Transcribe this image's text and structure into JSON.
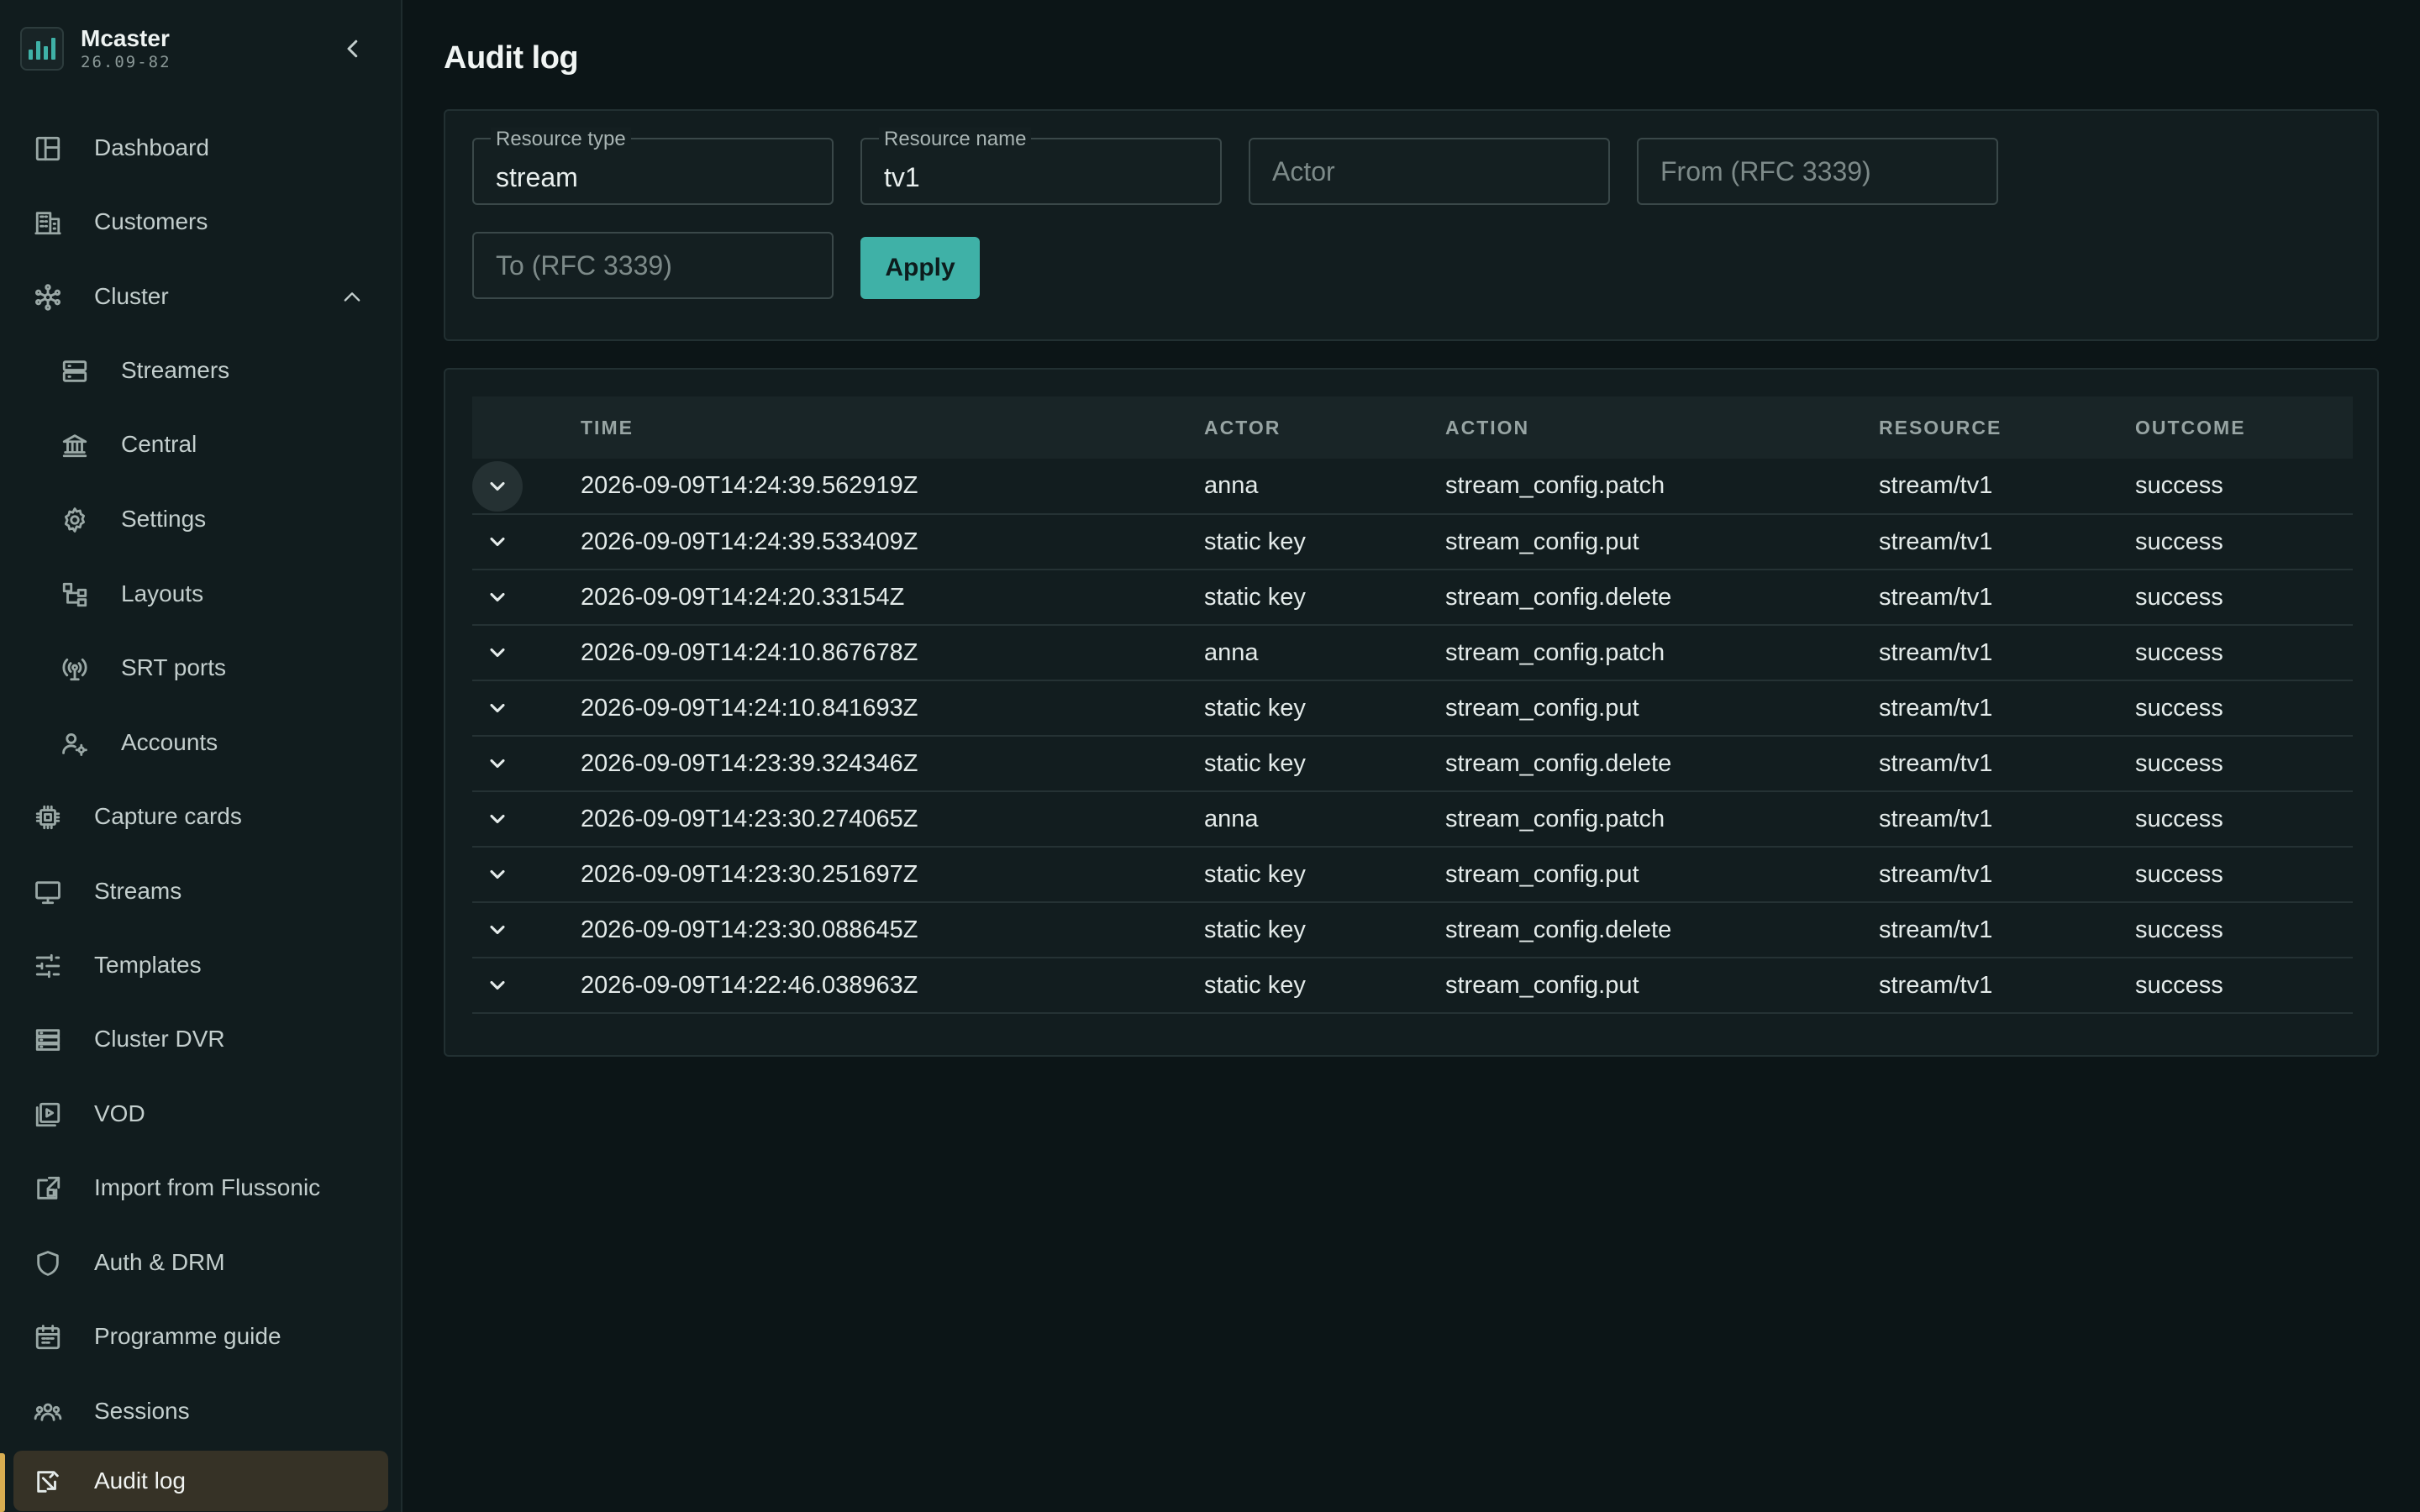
{
  "app": {
    "name": "Mcaster",
    "version": "26.09-82"
  },
  "colors": {
    "accent": "#3fb1a7",
    "active_indicator": "#d8ad51",
    "background": "#0c1517",
    "sidebar": "#111c1e"
  },
  "sidebar": {
    "collapse_icon": "chevron-left-icon",
    "items": [
      {
        "label": "Dashboard",
        "icon": "dashboard-icon"
      },
      {
        "label": "Customers",
        "icon": "building-icon"
      },
      {
        "label": "Cluster",
        "icon": "cluster-icon",
        "expanded": true
      },
      {
        "label": "Streamers",
        "icon": "server-icon"
      },
      {
        "label": "Central",
        "icon": "bank-icon"
      },
      {
        "label": "Settings",
        "icon": "gear-icon"
      },
      {
        "label": "Layouts",
        "icon": "hierarchy-icon"
      },
      {
        "label": "SRT ports",
        "icon": "antenna-icon"
      },
      {
        "label": "Accounts",
        "icon": "user-gear-icon"
      },
      {
        "label": "Capture cards",
        "icon": "chip-icon"
      },
      {
        "label": "Streams",
        "icon": "monitor-icon"
      },
      {
        "label": "Templates",
        "icon": "sliders-icon"
      },
      {
        "label": "Cluster DVR",
        "icon": "storage-icon"
      },
      {
        "label": "VOD",
        "icon": "video-library-icon"
      },
      {
        "label": "Import from Flussonic",
        "icon": "import-icon"
      },
      {
        "label": "Auth & DRM",
        "icon": "shield-icon"
      },
      {
        "label": "Programme guide",
        "icon": "calendar-icon"
      },
      {
        "label": "Sessions",
        "icon": "users-icon"
      },
      {
        "label": "Audit log",
        "icon": "audit-icon",
        "active": true
      }
    ]
  },
  "page": {
    "title": "Audit log"
  },
  "filters": {
    "resource_type": {
      "label": "Resource type",
      "value": "stream"
    },
    "resource_name": {
      "label": "Resource name",
      "value": "tv1"
    },
    "actor": {
      "placeholder": "Actor",
      "value": ""
    },
    "from": {
      "placeholder": "From (RFC 3339)",
      "value": ""
    },
    "to": {
      "placeholder": "To (RFC 3339)",
      "value": ""
    },
    "apply_label": "Apply"
  },
  "table": {
    "columns": [
      "TIME",
      "ACTOR",
      "ACTION",
      "RESOURCE",
      "OUTCOME"
    ],
    "rows": [
      {
        "time": "2026-09-09T14:24:39.562919Z",
        "actor": "anna",
        "action": "stream_config.patch",
        "resource": "stream/tv1",
        "outcome": "success"
      },
      {
        "time": "2026-09-09T14:24:39.533409Z",
        "actor": "static key",
        "action": "stream_config.put",
        "resource": "stream/tv1",
        "outcome": "success"
      },
      {
        "time": "2026-09-09T14:24:20.33154Z",
        "actor": "static key",
        "action": "stream_config.delete",
        "resource": "stream/tv1",
        "outcome": "success"
      },
      {
        "time": "2026-09-09T14:24:10.867678Z",
        "actor": "anna",
        "action": "stream_config.patch",
        "resource": "stream/tv1",
        "outcome": "success"
      },
      {
        "time": "2026-09-09T14:24:10.841693Z",
        "actor": "static key",
        "action": "stream_config.put",
        "resource": "stream/tv1",
        "outcome": "success"
      },
      {
        "time": "2026-09-09T14:23:39.324346Z",
        "actor": "static key",
        "action": "stream_config.delete",
        "resource": "stream/tv1",
        "outcome": "success"
      },
      {
        "time": "2026-09-09T14:23:30.274065Z",
        "actor": "anna",
        "action": "stream_config.patch",
        "resource": "stream/tv1",
        "outcome": "success"
      },
      {
        "time": "2026-09-09T14:23:30.251697Z",
        "actor": "static key",
        "action": "stream_config.put",
        "resource": "stream/tv1",
        "outcome": "success"
      },
      {
        "time": "2026-09-09T14:23:30.088645Z",
        "actor": "static key",
        "action": "stream_config.delete",
        "resource": "stream/tv1",
        "outcome": "success"
      },
      {
        "time": "2026-09-09T14:22:46.038963Z",
        "actor": "static key",
        "action": "stream_config.put",
        "resource": "stream/tv1",
        "outcome": "success"
      }
    ]
  }
}
